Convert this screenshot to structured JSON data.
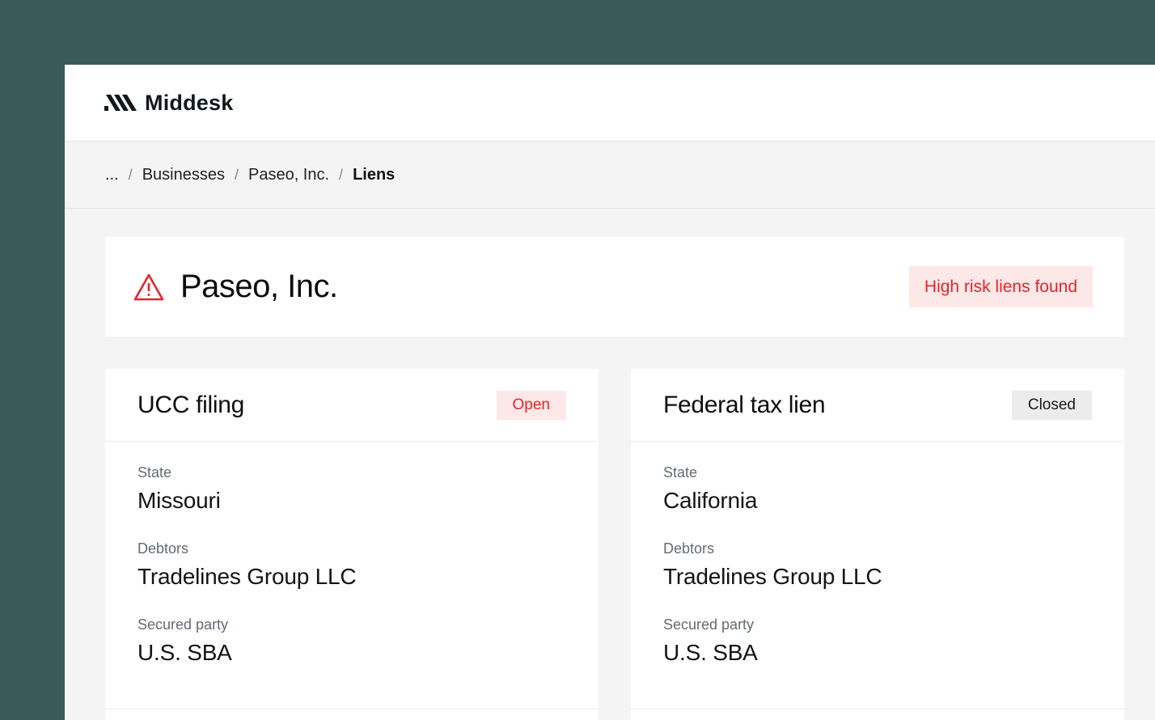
{
  "app": {
    "name": "Middesk"
  },
  "breadcrumb": {
    "items": [
      "...",
      "Businesses",
      "Paseo, Inc.",
      "Liens"
    ],
    "separator": "/"
  },
  "business": {
    "name": "Paseo, Inc.",
    "risk_badge": "High risk liens found",
    "icon": "warning-triangle-icon"
  },
  "liens": [
    {
      "title": "UCC filing",
      "status": "Open",
      "fields": [
        {
          "label": "State",
          "value": "Missouri"
        },
        {
          "label": "Debtors",
          "value": "Tradelines Group LLC"
        },
        {
          "label": "Secured party",
          "value": "U.S. SBA"
        }
      ]
    },
    {
      "title": "Federal tax lien",
      "status": "Closed",
      "fields": [
        {
          "label": "State",
          "value": "California"
        },
        {
          "label": "Debtors",
          "value": "Tradelines Group LLC"
        },
        {
          "label": "Secured party",
          "value": "U.S. SBA"
        }
      ]
    }
  ],
  "colors": {
    "background": "#3a5a59",
    "danger": "#e5242a",
    "danger_bg": "#fde8e8",
    "neutral_bg": "#ececec"
  }
}
